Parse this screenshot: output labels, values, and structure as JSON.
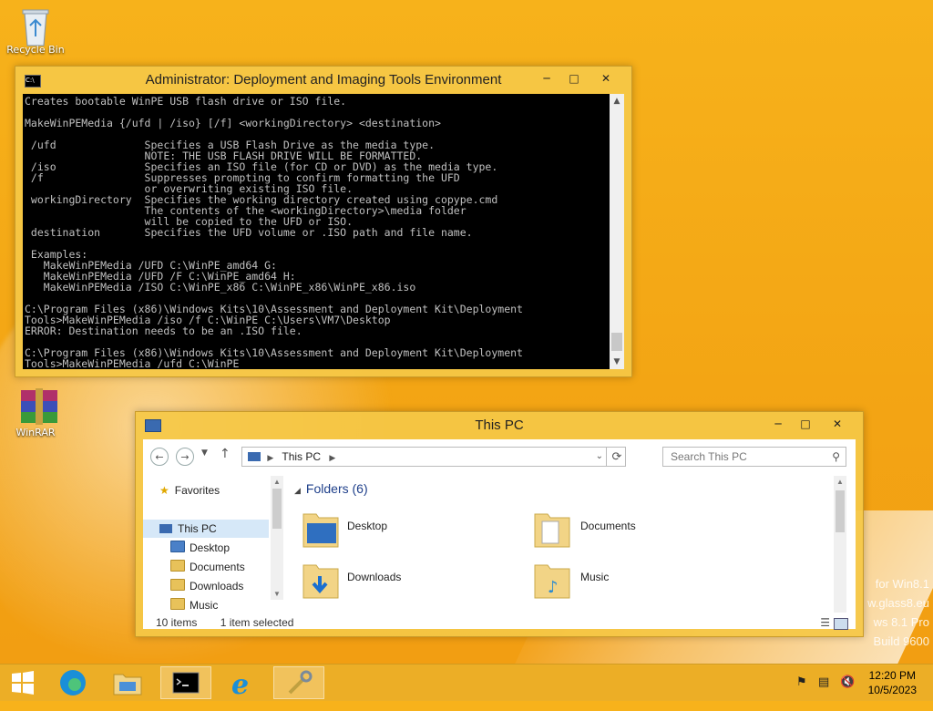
{
  "desktop": {
    "icons": [
      {
        "label": "Recycle Bin"
      },
      {
        "label": "WinRAR"
      }
    ],
    "watermark": [
      "for Win8.1",
      "w.glass8.eu",
      "ws 8.1 Pro",
      "Build 9600"
    ]
  },
  "console": {
    "title": "Administrator: Deployment and Imaging Tools Environment",
    "lines": [
      "Creates bootable WinPE USB flash drive or ISO file.",
      "",
      "MakeWinPEMedia {/ufd | /iso} [/f] <workingDirectory> <destination>",
      "",
      " /ufd              Specifies a USB Flash Drive as the media type.",
      "                   NOTE: THE USB FLASH DRIVE WILL BE FORMATTED.",
      " /iso              Specifies an ISO file (for CD or DVD) as the media type.",
      " /f                Suppresses prompting to confirm formatting the UFD",
      "                   or overwriting existing ISO file.",
      " workingDirectory  Specifies the working directory created using copype.cmd",
      "                   The contents of the <workingDirectory>\\media folder",
      "                   will be copied to the UFD or ISO.",
      " destination       Specifies the UFD volume or .ISO path and file name.",
      "",
      " Examples:",
      "   MakeWinPEMedia /UFD C:\\WinPE_amd64 G:",
      "   MakeWinPEMedia /UFD /F C:\\WinPE_amd64 H:",
      "   MakeWinPEMedia /ISO C:\\WinPE_x86 C:\\WinPE_x86\\WinPE_x86.iso",
      "",
      "C:\\Program Files (x86)\\Windows Kits\\10\\Assessment and Deployment Kit\\Deployment",
      "Tools>MakeWinPEMedia /iso /f C:\\WinPE C:\\Users\\VM7\\Desktop",
      "ERROR: Destination needs to be an .ISO file.",
      "",
      "C:\\Program Files (x86)\\Windows Kits\\10\\Assessment and Deployment Kit\\Deployment",
      "Tools>MakeWinPEMedia /ufd C:\\WinPE"
    ]
  },
  "explorer": {
    "title": "This PC",
    "address": "This PC",
    "search_placeholder": "Search This PC",
    "nav": {
      "favorites": "Favorites",
      "this_pc": "This PC",
      "children": [
        "Desktop",
        "Documents",
        "Downloads",
        "Music"
      ]
    },
    "group_header": "Folders (6)",
    "folders": [
      "Desktop",
      "Documents",
      "Downloads",
      "Music"
    ],
    "status_items": "10 items",
    "status_selected": "1 item selected"
  },
  "taskbar": {
    "time": "12:20 PM",
    "date": "10/5/2023"
  }
}
